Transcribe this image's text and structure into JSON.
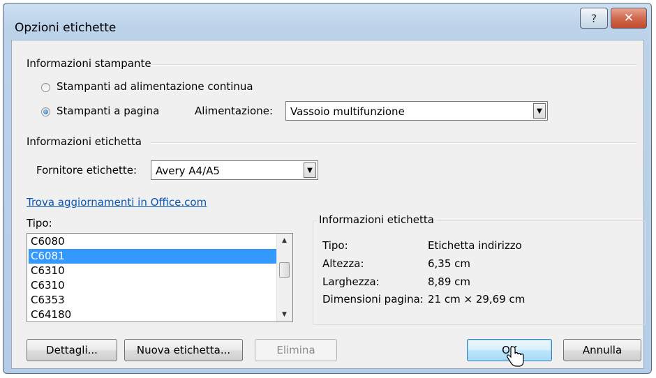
{
  "dialog": {
    "title": "Opzioni etichette",
    "help_glyph": "?",
    "close_glyph": "✕"
  },
  "printer_info": {
    "group_label": "Informazioni stampante",
    "continuous_label": "Stampanti ad alimentazione continua",
    "page_label": "Stampanti a pagina",
    "selected": "page",
    "feed_label": "Alimentazione:",
    "feed_value": "Vassoio multifunzione"
  },
  "label_info": {
    "group_label": "Informazioni etichetta",
    "vendor_label": "Fornitore etichette:",
    "vendor_value": "Avery A4/A5",
    "update_link": "Trova aggiornamenti in Office.com"
  },
  "type_list": {
    "label": "Tipo:",
    "items": [
      "C6080",
      "C6081",
      "C6310",
      "C6310",
      "C6353",
      "C64180"
    ],
    "selected_index": 1
  },
  "details": {
    "group_label": "Informazioni etichetta",
    "rows": [
      {
        "label": "Tipo:",
        "value": "Etichetta indirizzo"
      },
      {
        "label": "Altezza:",
        "value": "6,35 cm"
      },
      {
        "label": "Larghezza:",
        "value": "8,89 cm"
      },
      {
        "label": "Dimensioni pagina:",
        "value": "21 cm × 29,69 cm"
      }
    ]
  },
  "buttons": {
    "details": "Dettagli...",
    "new_label": "Nuova etichetta...",
    "delete": "Elimina",
    "ok": "OK",
    "cancel": "Annulla"
  },
  "icons": {
    "dropdown": "chevron-down-icon",
    "scroll_up": "scroll-up-icon",
    "scroll_down": "scroll-down-icon",
    "cursor": "mouse-pointer-icon"
  }
}
